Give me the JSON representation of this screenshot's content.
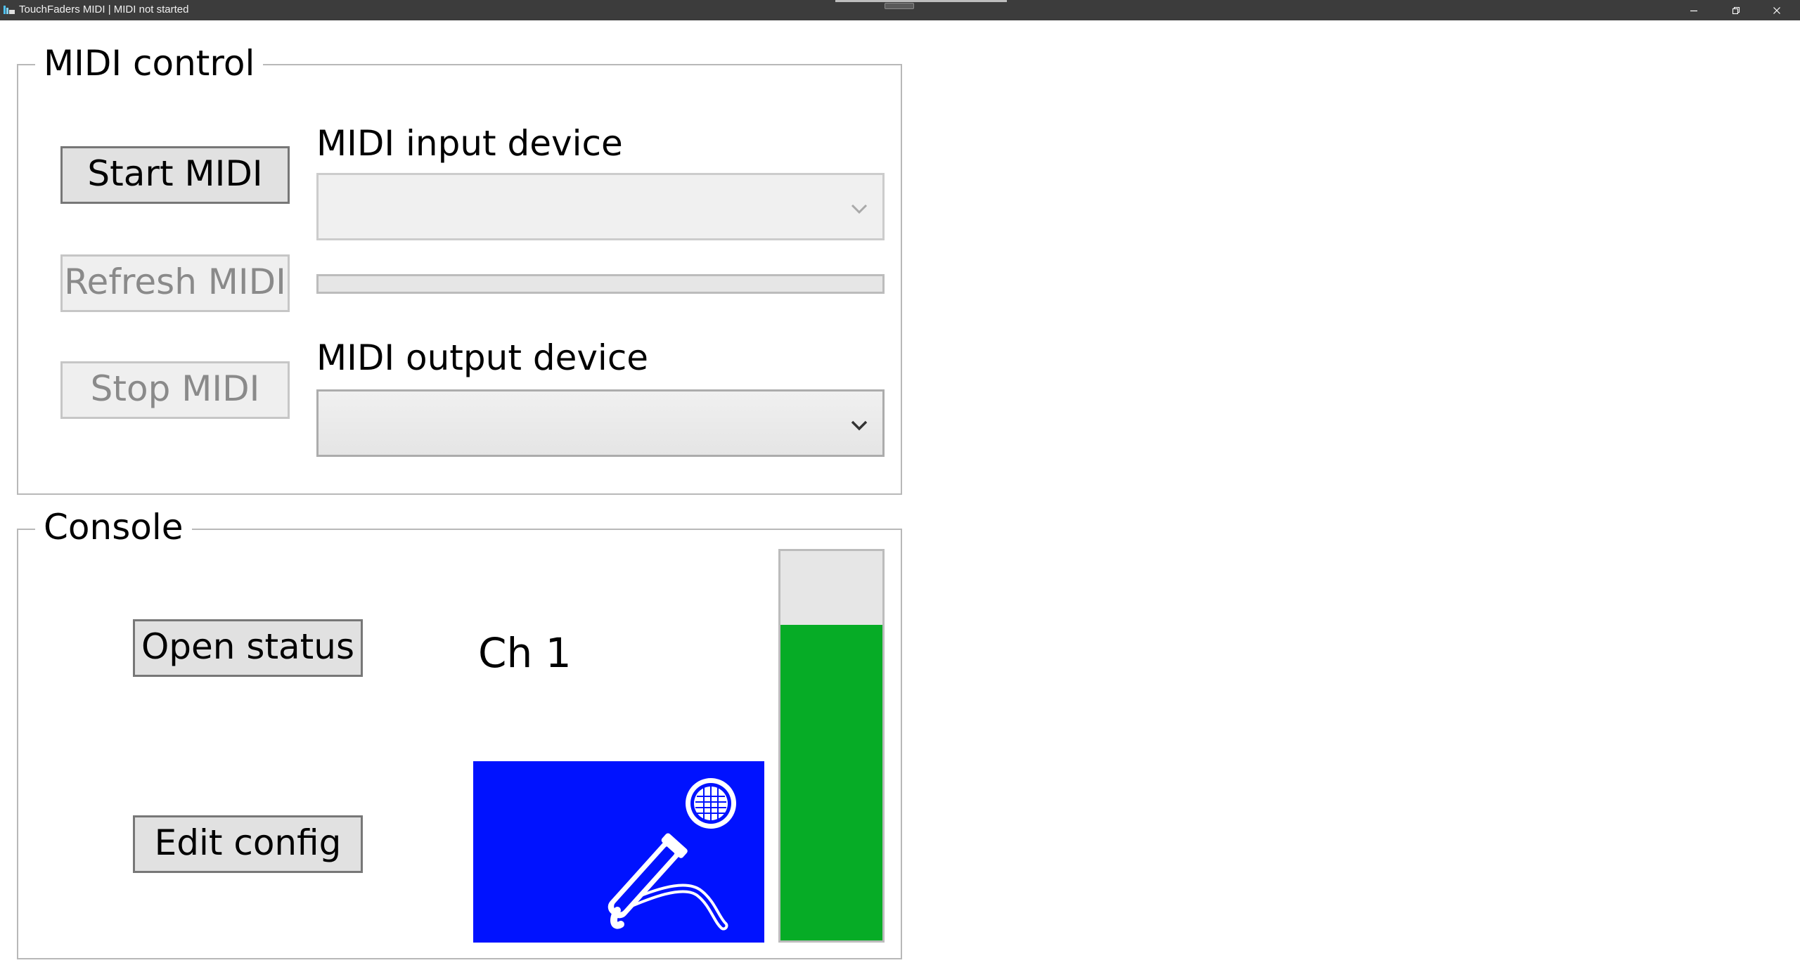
{
  "window": {
    "title": "TouchFaders MIDI | MIDI not started",
    "controls": {
      "minimize": "minimize-icon",
      "restore": "restore-icon",
      "close": "close-icon"
    }
  },
  "midi_control": {
    "title": "MIDI control",
    "start_label": "Start MIDI",
    "refresh_label": "Refresh MIDI",
    "stop_label": "Stop MIDI",
    "input_label": "MIDI input device",
    "input_value": "",
    "output_label": "MIDI output device",
    "output_value": "",
    "progress_fraction": 0
  },
  "console": {
    "title": "Console",
    "open_status_label": "Open status",
    "edit_config_label": "Edit config",
    "channel_label": "Ch 1",
    "channel_icon": "microphone-icon",
    "channel_bg_color": "#0012ff",
    "meter_level_fraction": 0.81,
    "meter_color": "#06ac26"
  }
}
